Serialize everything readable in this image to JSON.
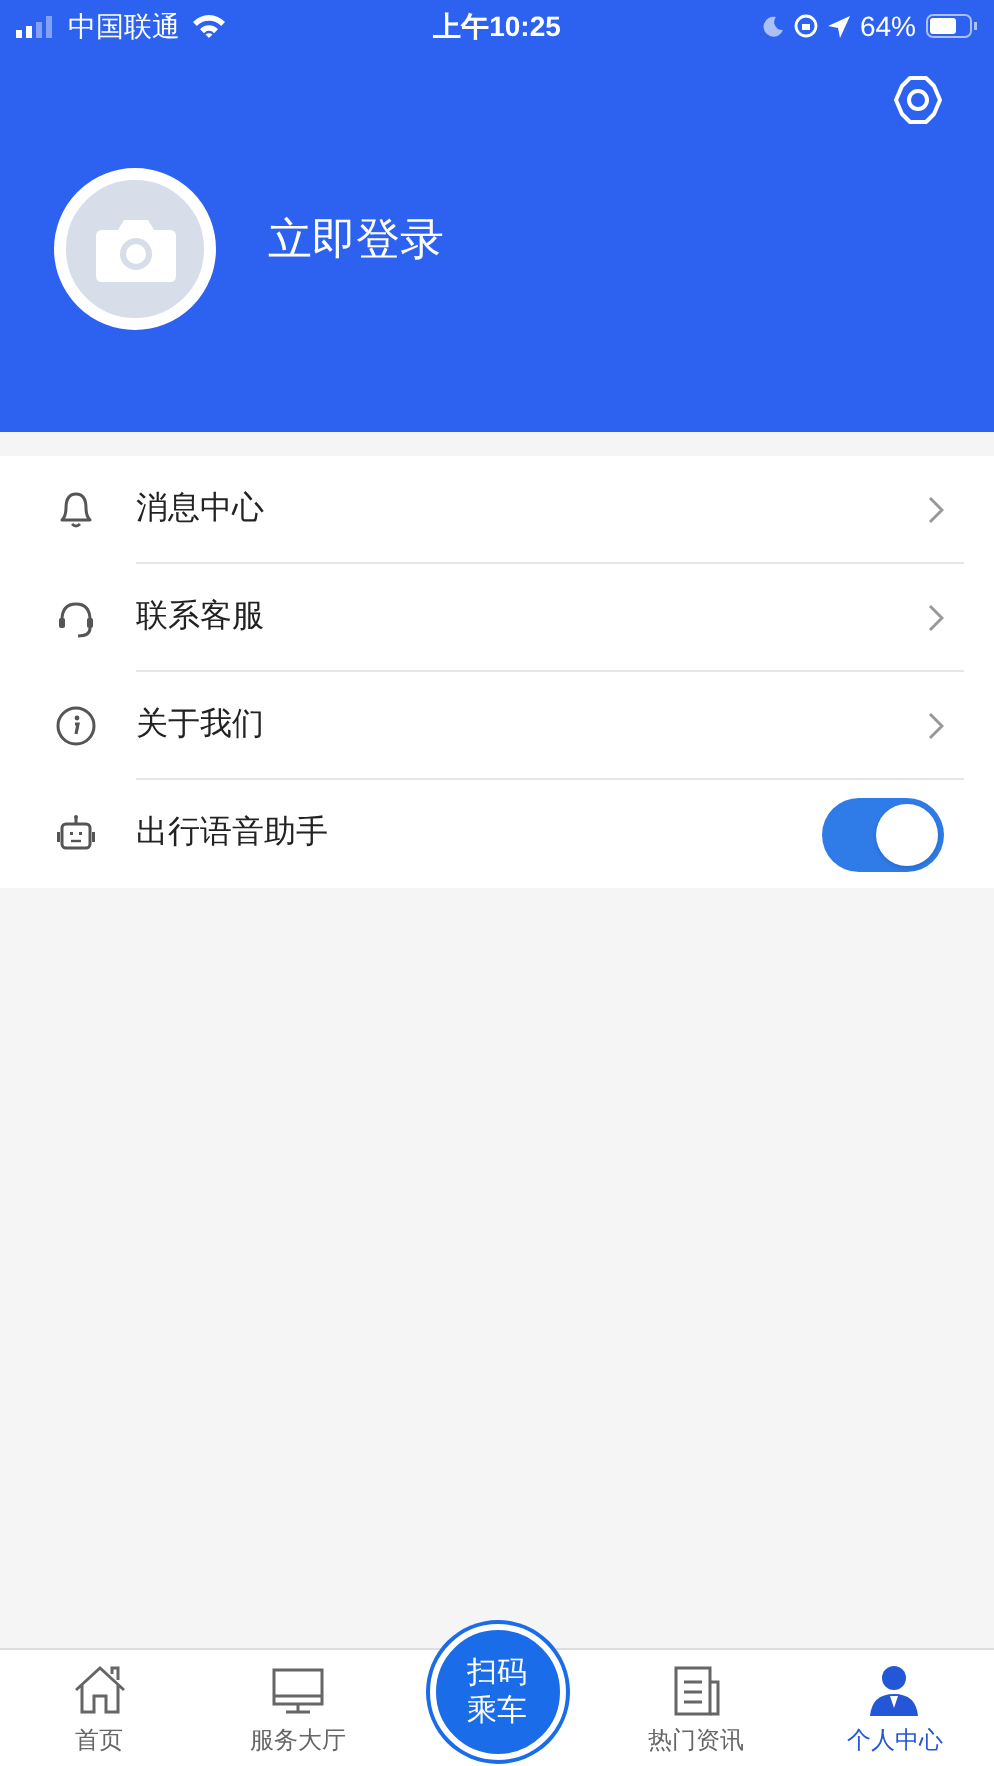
{
  "status_bar": {
    "carrier": "中国联通",
    "time": "上午10:25",
    "battery": "64%"
  },
  "header": {
    "login": "立即登录"
  },
  "menu": [
    {
      "kind": "link",
      "label": "消息中心"
    },
    {
      "kind": "link",
      "label": "联系客服"
    },
    {
      "kind": "link",
      "label": "关于我们"
    },
    {
      "kind": "toggle",
      "label": "出行语音助手",
      "on": true
    }
  ],
  "tab_bar": [
    {
      "kind": "tab",
      "label": "首页",
      "selected": false
    },
    {
      "kind": "tab",
      "label": "服务大厅",
      "selected": false
    },
    {
      "kind": "scan",
      "label": "扫码乘车",
      "selected": false
    },
    {
      "kind": "tab",
      "label": "热门资讯",
      "selected": false
    },
    {
      "kind": "tab",
      "label": "个人中心",
      "selected": true
    }
  ]
}
